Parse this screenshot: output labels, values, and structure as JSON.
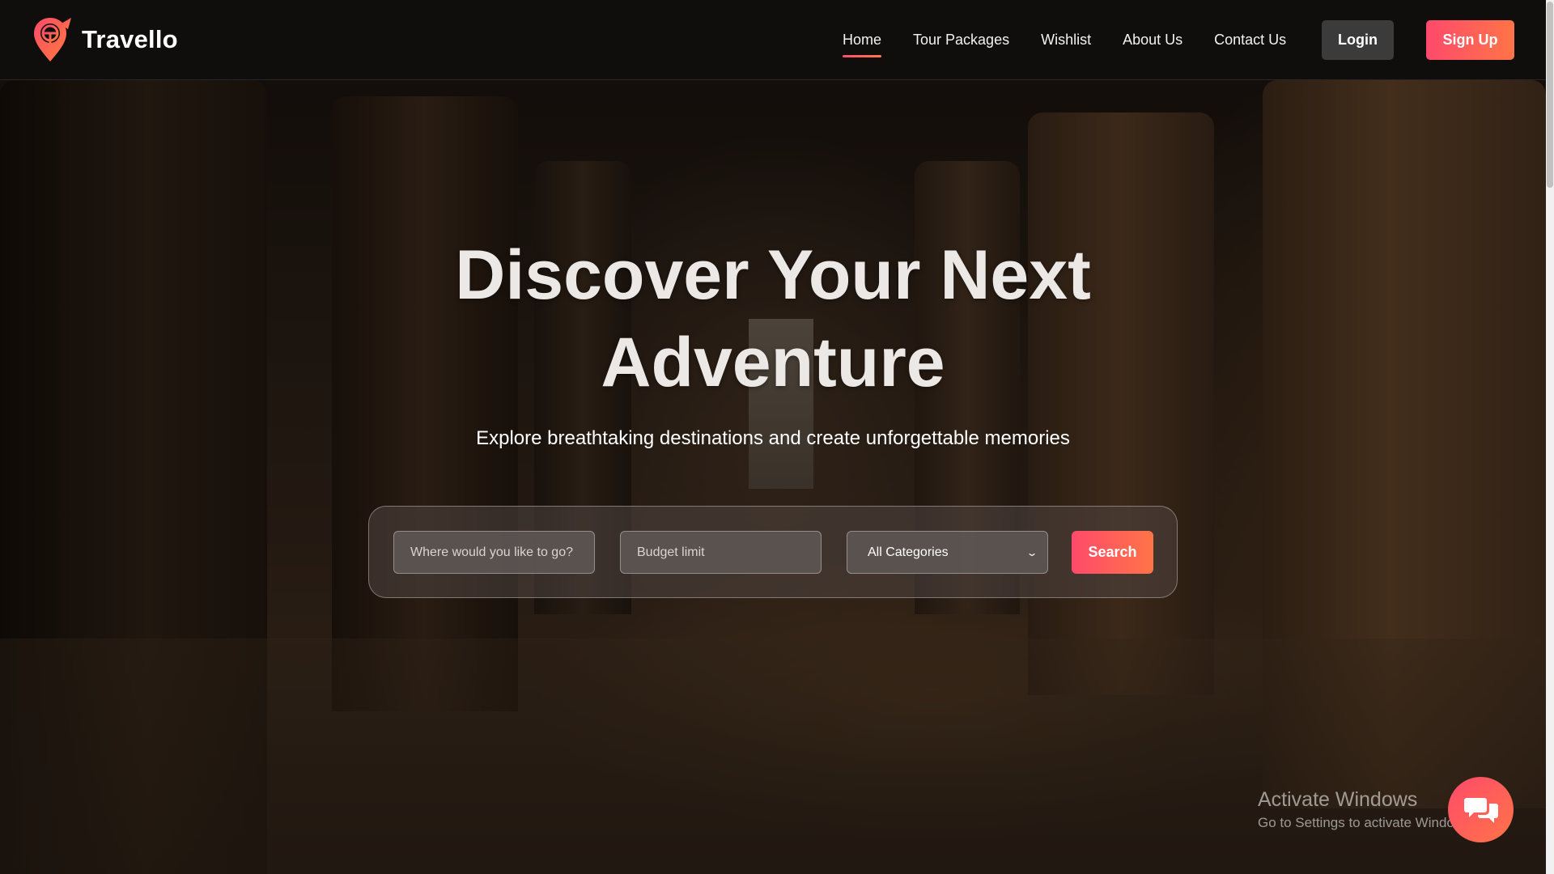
{
  "brand": {
    "name": "Travello",
    "logo_icon": "location-pin-logo-icon"
  },
  "nav": {
    "links": [
      {
        "label": "Home",
        "active": true
      },
      {
        "label": "Tour Packages",
        "active": false
      },
      {
        "label": "Wishlist",
        "active": false
      },
      {
        "label": "About Us",
        "active": false
      },
      {
        "label": "Contact Us",
        "active": false
      }
    ],
    "login_label": "Login",
    "signup_label": "Sign Up"
  },
  "hero": {
    "title_line1": "Discover Your Next",
    "title_line2": "Adventure",
    "subtitle": "Explore breathtaking destinations and create unforgettable memories"
  },
  "search": {
    "destination_placeholder": "Where would you like to go?",
    "destination_value": "",
    "budget_placeholder": "Budget limit",
    "budget_value": "",
    "category_selected": "All Categories",
    "button_label": "Search"
  },
  "watermark": {
    "title": "Activate Windows",
    "subtitle": "Go to Settings to activate Windows."
  },
  "chat": {
    "icon": "chat-bubbles-icon"
  },
  "colors": {
    "accent_start": "#ff4a6b",
    "accent_end": "#ff7447",
    "nav_bg": "#0f0e0d",
    "login_bg": "#3b3b3c"
  }
}
